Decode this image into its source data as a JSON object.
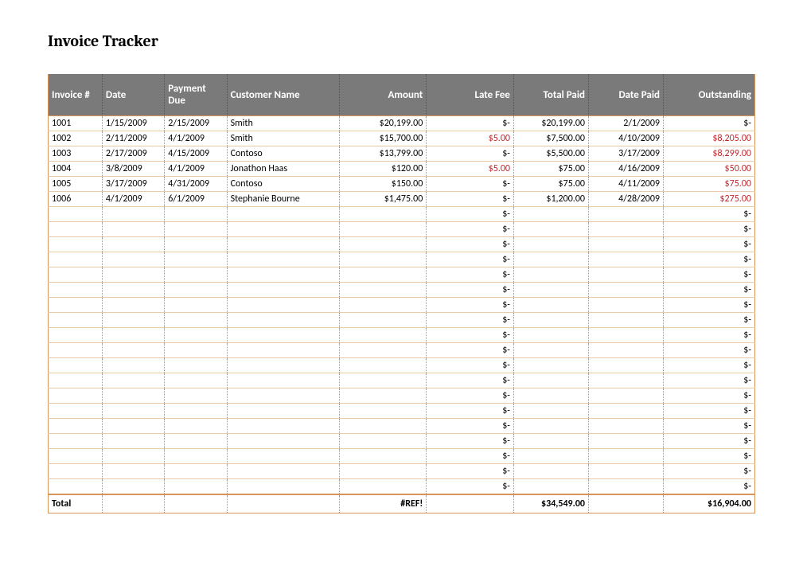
{
  "title": "Invoice Tracker",
  "headers": {
    "invoice": "Invoice #",
    "date": "Date",
    "payment_due": "Payment Due",
    "customer": "Customer Name",
    "amount": "Amount",
    "late_fee": "Late Fee",
    "total_paid": "Total Paid",
    "date_paid": "Date Paid",
    "outstanding": "Outstanding"
  },
  "rows": [
    {
      "invoice": "1001",
      "date": "1/15/2009",
      "payment_due": "2/15/2009",
      "customer": "Smith",
      "amount": "$20,199.00",
      "late_fee": "$-",
      "late_red": false,
      "total_paid": "$20,199.00",
      "date_paid": "2/1/2009",
      "outstanding": "$-",
      "out_red": false
    },
    {
      "invoice": "1002",
      "date": "2/11/2009",
      "payment_due": "4/1/2009",
      "customer": "Smith",
      "amount": "$15,700.00",
      "late_fee": "$5.00",
      "late_red": true,
      "total_paid": "$7,500.00",
      "date_paid": "4/10/2009",
      "outstanding": "$8,205.00",
      "out_red": true
    },
    {
      "invoice": "1003",
      "date": "2/17/2009",
      "payment_due": "4/15/2009",
      "customer": "Contoso",
      "amount": "$13,799.00",
      "late_fee": "$-",
      "late_red": false,
      "total_paid": "$5,500.00",
      "date_paid": "3/17/2009",
      "outstanding": "$8,299.00",
      "out_red": true
    },
    {
      "invoice": "1004",
      "date": "3/8/2009",
      "payment_due": "4/1/2009",
      "customer": "Jonathon Haas",
      "amount": "$120.00",
      "late_fee": "$5.00",
      "late_red": true,
      "total_paid": "$75.00",
      "date_paid": "4/16/2009",
      "outstanding": "$50.00",
      "out_red": true
    },
    {
      "invoice": "1005",
      "date": "3/17/2009",
      "payment_due": "4/31/2009",
      "customer": "Contoso",
      "amount": "$150.00",
      "late_fee": "$-",
      "late_red": false,
      "total_paid": "$75.00",
      "date_paid": "4/11/2009",
      "outstanding": "$75.00",
      "out_red": true
    },
    {
      "invoice": "1006",
      "date": "4/1/2009",
      "payment_due": "6/1/2009",
      "customer": "Stephanie Bourne",
      "amount": "$1,475.00",
      "late_fee": "$-",
      "late_red": false,
      "total_paid": "$1,200.00",
      "date_paid": "4/28/2009",
      "outstanding": "$275.00",
      "out_red": true
    },
    {
      "invoice": "",
      "date": "",
      "payment_due": "",
      "customer": "",
      "amount": "",
      "late_fee": "$-",
      "late_red": false,
      "total_paid": "",
      "date_paid": "",
      "outstanding": "$-",
      "out_red": false
    },
    {
      "invoice": "",
      "date": "",
      "payment_due": "",
      "customer": "",
      "amount": "",
      "late_fee": "$-",
      "late_red": false,
      "total_paid": "",
      "date_paid": "",
      "outstanding": "$-",
      "out_red": false
    },
    {
      "invoice": "",
      "date": "",
      "payment_due": "",
      "customer": "",
      "amount": "",
      "late_fee": "$-",
      "late_red": false,
      "total_paid": "",
      "date_paid": "",
      "outstanding": "$-",
      "out_red": false
    },
    {
      "invoice": "",
      "date": "",
      "payment_due": "",
      "customer": "",
      "amount": "",
      "late_fee": "$-",
      "late_red": false,
      "total_paid": "",
      "date_paid": "",
      "outstanding": "$-",
      "out_red": false
    },
    {
      "invoice": "",
      "date": "",
      "payment_due": "",
      "customer": "",
      "amount": "",
      "late_fee": "$-",
      "late_red": false,
      "total_paid": "",
      "date_paid": "",
      "outstanding": "$-",
      "out_red": false
    },
    {
      "invoice": "",
      "date": "",
      "payment_due": "",
      "customer": "",
      "amount": "",
      "late_fee": "$-",
      "late_red": false,
      "total_paid": "",
      "date_paid": "",
      "outstanding": "$-",
      "out_red": false
    },
    {
      "invoice": "",
      "date": "",
      "payment_due": "",
      "customer": "",
      "amount": "",
      "late_fee": "$-",
      "late_red": false,
      "total_paid": "",
      "date_paid": "",
      "outstanding": "$-",
      "out_red": false
    },
    {
      "invoice": "",
      "date": "",
      "payment_due": "",
      "customer": "",
      "amount": "",
      "late_fee": "$-",
      "late_red": false,
      "total_paid": "",
      "date_paid": "",
      "outstanding": "$-",
      "out_red": false
    },
    {
      "invoice": "",
      "date": "",
      "payment_due": "",
      "customer": "",
      "amount": "",
      "late_fee": "$-",
      "late_red": false,
      "total_paid": "",
      "date_paid": "",
      "outstanding": "$-",
      "out_red": false
    },
    {
      "invoice": "",
      "date": "",
      "payment_due": "",
      "customer": "",
      "amount": "",
      "late_fee": "$-",
      "late_red": false,
      "total_paid": "",
      "date_paid": "",
      "outstanding": "$-",
      "out_red": false
    },
    {
      "invoice": "",
      "date": "",
      "payment_due": "",
      "customer": "",
      "amount": "",
      "late_fee": "$-",
      "late_red": false,
      "total_paid": "",
      "date_paid": "",
      "outstanding": "$-",
      "out_red": false
    },
    {
      "invoice": "",
      "date": "",
      "payment_due": "",
      "customer": "",
      "amount": "",
      "late_fee": "$-",
      "late_red": false,
      "total_paid": "",
      "date_paid": "",
      "outstanding": "$-",
      "out_red": false
    },
    {
      "invoice": "",
      "date": "",
      "payment_due": "",
      "customer": "",
      "amount": "",
      "late_fee": "$-",
      "late_red": false,
      "total_paid": "",
      "date_paid": "",
      "outstanding": "$-",
      "out_red": false
    },
    {
      "invoice": "",
      "date": "",
      "payment_due": "",
      "customer": "",
      "amount": "",
      "late_fee": "$-",
      "late_red": false,
      "total_paid": "",
      "date_paid": "",
      "outstanding": "$-",
      "out_red": false
    },
    {
      "invoice": "",
      "date": "",
      "payment_due": "",
      "customer": "",
      "amount": "",
      "late_fee": "$-",
      "late_red": false,
      "total_paid": "",
      "date_paid": "",
      "outstanding": "$-",
      "out_red": false
    },
    {
      "invoice": "",
      "date": "",
      "payment_due": "",
      "customer": "",
      "amount": "",
      "late_fee": "$-",
      "late_red": false,
      "total_paid": "",
      "date_paid": "",
      "outstanding": "$-",
      "out_red": false
    },
    {
      "invoice": "",
      "date": "",
      "payment_due": "",
      "customer": "",
      "amount": "",
      "late_fee": "$-",
      "late_red": false,
      "total_paid": "",
      "date_paid": "",
      "outstanding": "$-",
      "out_red": false
    },
    {
      "invoice": "",
      "date": "",
      "payment_due": "",
      "customer": "",
      "amount": "",
      "late_fee": "$-",
      "late_red": false,
      "total_paid": "",
      "date_paid": "",
      "outstanding": "$-",
      "out_red": false
    },
    {
      "invoice": "",
      "date": "",
      "payment_due": "",
      "customer": "",
      "amount": "",
      "late_fee": "$-",
      "late_red": false,
      "total_paid": "",
      "date_paid": "",
      "outstanding": "$-",
      "out_red": false
    }
  ],
  "totals": {
    "label": "Total",
    "amount": "#REF!",
    "total_paid": "$34,549.00",
    "outstanding": "$16,904.00"
  }
}
